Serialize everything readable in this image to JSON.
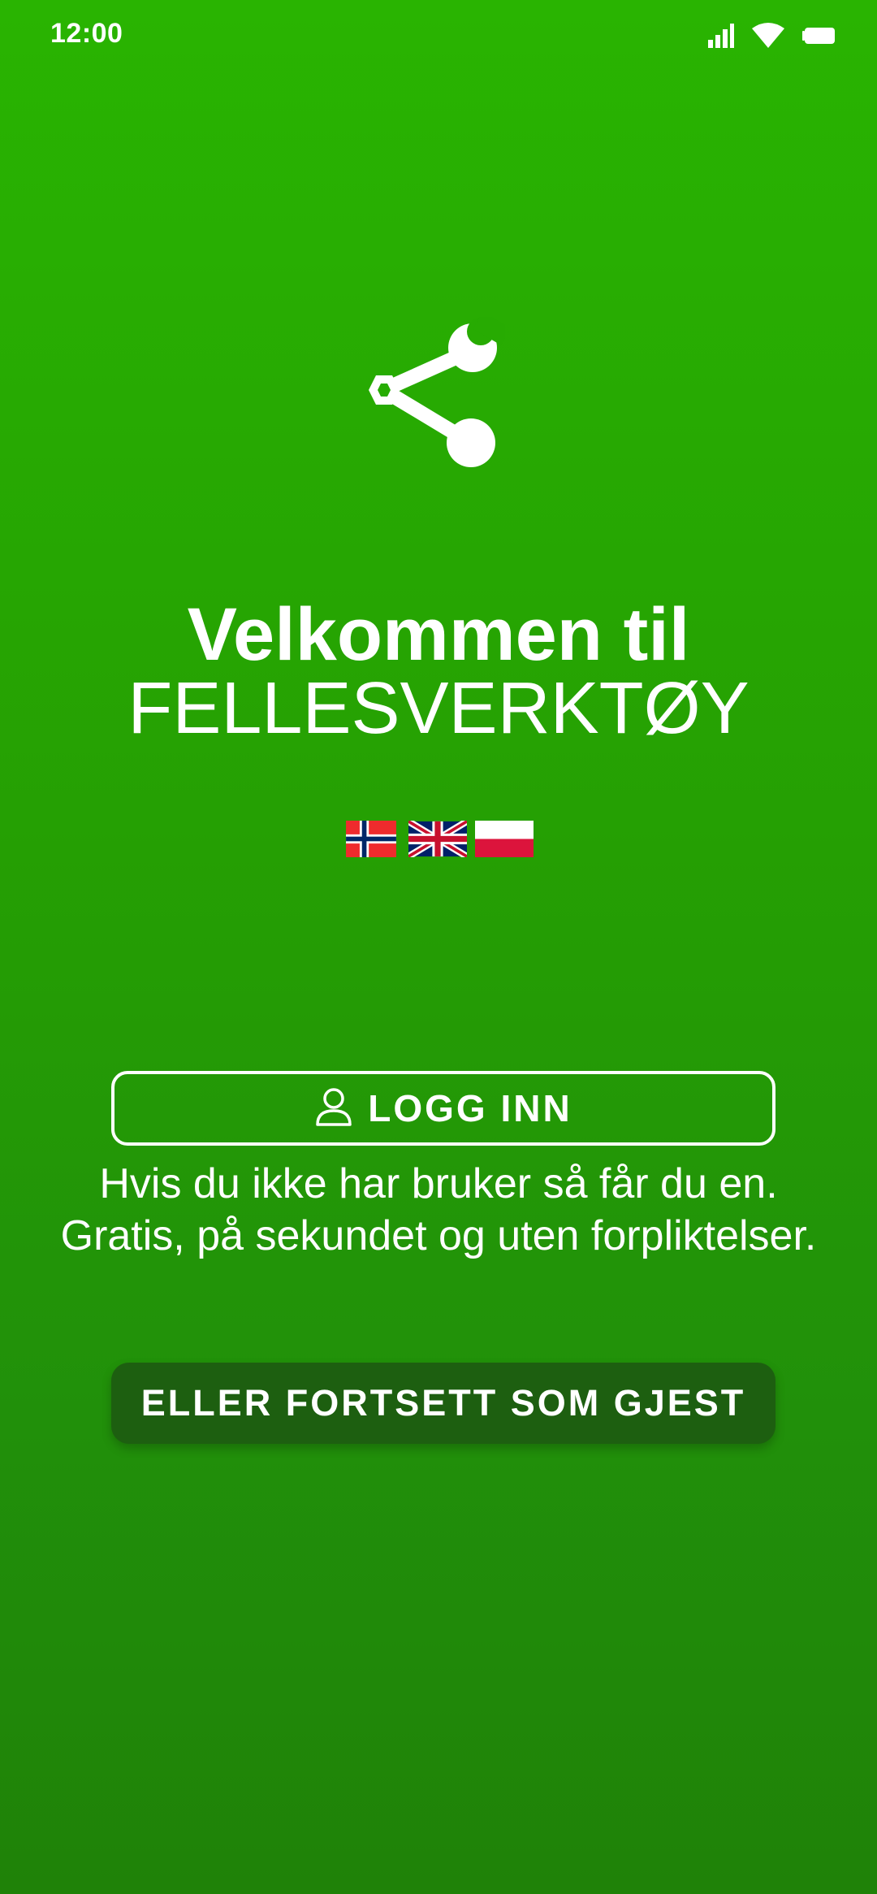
{
  "status_bar": {
    "time": "12:00",
    "icons": [
      "signal-icon",
      "wifi-icon",
      "battery-icon"
    ]
  },
  "logo": {
    "icon": "share-wrench-icon"
  },
  "welcome": {
    "line1": "Velkommen til",
    "line2": "FELLESVERKTØY"
  },
  "languages": [
    {
      "code": "no",
      "icon": "flag-norway-icon"
    },
    {
      "code": "en",
      "icon": "flag-uk-icon"
    },
    {
      "code": "pl",
      "icon": "flag-poland-icon"
    }
  ],
  "login": {
    "icon": "user-icon",
    "label": "LOGG INN"
  },
  "info": {
    "line1": "Hvis du ikke har bruker så får du en.",
    "line2": "Gratis, på sekundet og uten forpliktelser."
  },
  "guest": {
    "label": "ELLER FORTSETT SOM GJEST"
  },
  "colors": {
    "background_top": "#29b401",
    "background_bottom": "#1f8208",
    "guest_button": "#1d5f10",
    "text": "#ffffff"
  }
}
